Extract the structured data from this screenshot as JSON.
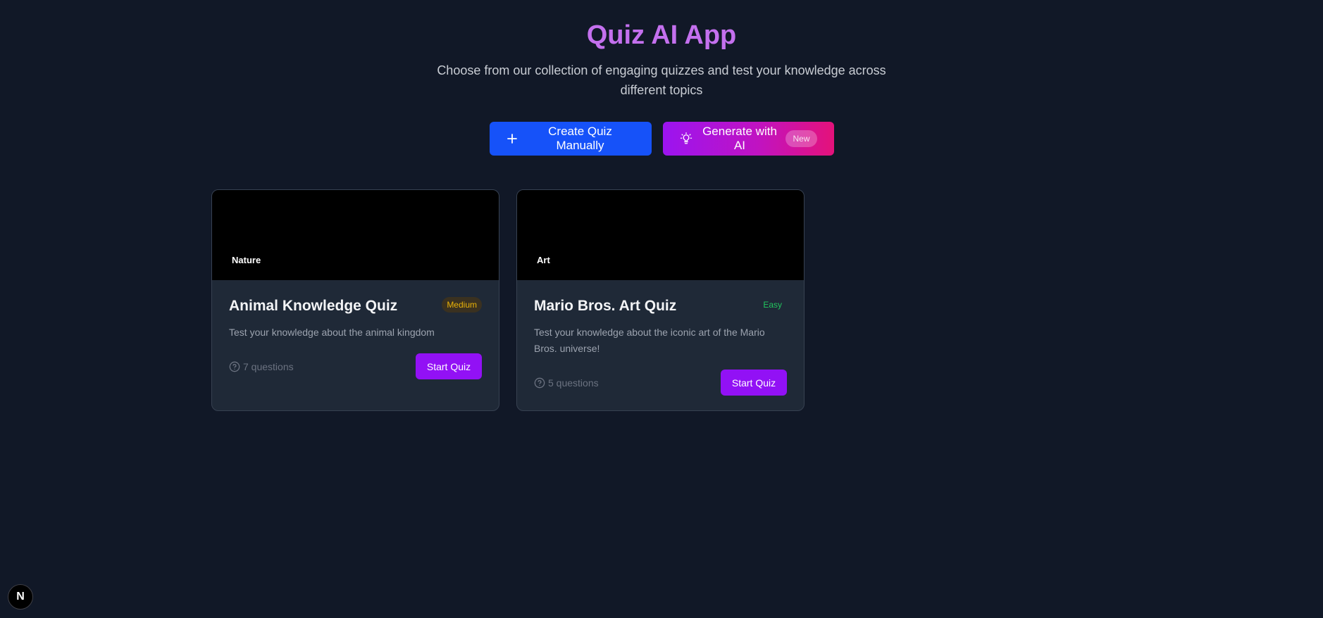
{
  "header": {
    "title": "Quiz AI App",
    "subtitle": "Choose from our collection of engaging quizzes and test your knowledge across different topics"
  },
  "actions": {
    "create_label": "Create Quiz Manually",
    "create_icon": "plus-icon",
    "ai_label": "Generate with AI",
    "ai_icon": "lightbulb-icon",
    "ai_badge": "New"
  },
  "quizzes": [
    {
      "category": "Nature",
      "title": "Animal Knowledge Quiz",
      "difficulty": "Medium",
      "description": "Test your knowledge about the animal kingdom",
      "questions": "7 questions",
      "button": "Start Quiz"
    },
    {
      "category": "Art",
      "title": "Mario Bros. Art Quiz",
      "difficulty": "Easy",
      "description": "Test your knowledge about the iconic art of the Mario Bros. universe!",
      "questions": "5 questions",
      "button": "Start Quiz"
    }
  ],
  "dev_badge": {
    "label": "N"
  },
  "colors": {
    "background": "#111827",
    "title": "#c470ee",
    "create_button": "#1652f9",
    "ai_gradient_start": "#9b14f0",
    "ai_gradient_end": "#e4127a",
    "start_button": "#9211f5",
    "medium": "#eab308",
    "easy": "#22c55e"
  }
}
